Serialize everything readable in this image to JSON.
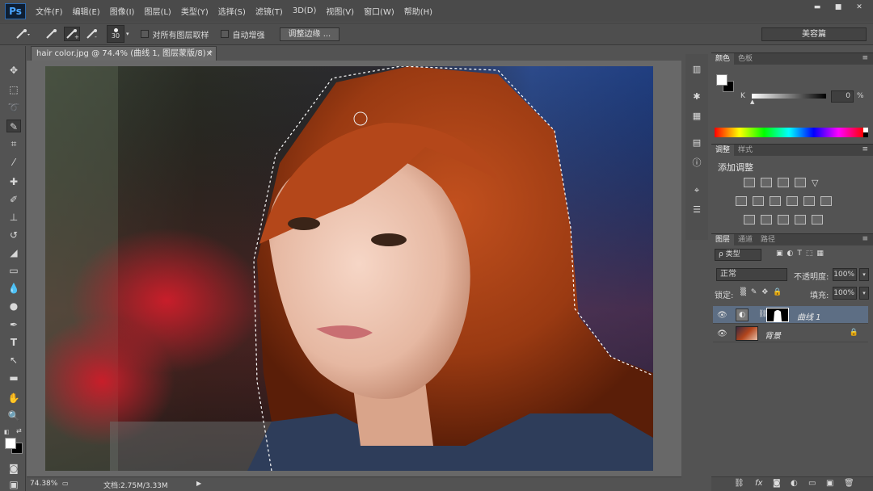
{
  "app": {
    "logo": "Ps"
  },
  "menu": [
    "文件(F)",
    "编辑(E)",
    "图像(I)",
    "图层(L)",
    "类型(Y)",
    "选择(S)",
    "滤镜(T)",
    "3D(D)",
    "视图(V)",
    "窗口(W)",
    "帮助(H)"
  ],
  "window_controls": {
    "minimize": "▬",
    "maximize": "■",
    "close": "✕"
  },
  "options": {
    "brush_size": "30",
    "sample_all_layers": "对所有图层取样",
    "auto_enhance": "自动增强",
    "refine_edge": "调整边缘 ...",
    "workspace": "美容篇"
  },
  "document": {
    "tab_title": "hair color.jpg @ 74.4% (曲线 1, 图层蒙版/8) *",
    "tab_close": "×",
    "zoom": "74.38%",
    "doc_info": "文档:2.75M/3.33M"
  },
  "color_panel": {
    "tabs": [
      "颜色",
      "色板"
    ],
    "channel": "K",
    "value": "0",
    "unit": "%"
  },
  "adjust_panel": {
    "tabs": [
      "调整",
      "样式"
    ],
    "title": "添加调整"
  },
  "layers_panel": {
    "tabs": [
      "图层",
      "通道",
      "路径"
    ],
    "filter": "ρ 类型",
    "blend_mode": "正常",
    "opacity_label": "不透明度:",
    "opacity_value": "100%",
    "lock_label": "锁定:",
    "fill_label": "填充:",
    "fill_value": "100%",
    "layers": [
      {
        "name": "曲线 1",
        "selected": true
      },
      {
        "name": "背景",
        "selected": false
      }
    ]
  },
  "colors": {
    "accent_selected_layer": "#5d6e84",
    "ui_bg": "#535353"
  }
}
